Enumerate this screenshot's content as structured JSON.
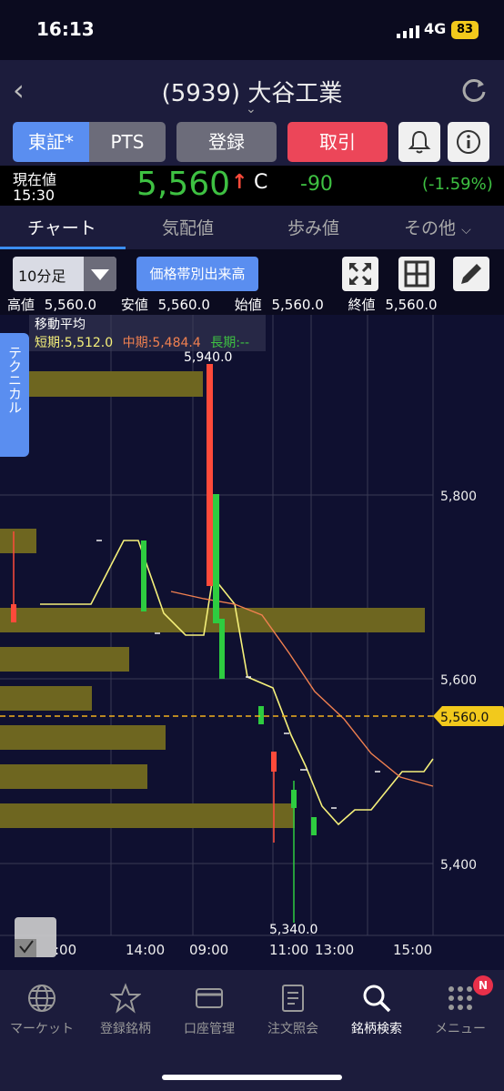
{
  "status": {
    "time": "16:13",
    "network": "4G",
    "battery": "83"
  },
  "header": {
    "title": "(5939) 大谷工業"
  },
  "buttons": {
    "tse": "東証*",
    "pts": "PTS",
    "register": "登録",
    "trade": "取引"
  },
  "price": {
    "label": "現在値",
    "time": "15:30",
    "value": "5,560",
    "flag": "C",
    "change": "-90",
    "change_pct": "(-1.59%)"
  },
  "tabs": [
    "チャート",
    "気配値",
    "歩み値",
    "その他"
  ],
  "controls": {
    "interval": "10分足",
    "volume_profile": "価格帯別出来高"
  },
  "ohlc": {
    "high_label": "高値",
    "high": "5,560.0",
    "low_label": "安値",
    "low": "5,560.0",
    "open_label": "始値",
    "open": "5,560.0",
    "close_label": "終値",
    "close": "5,560.0"
  },
  "ma": {
    "title": "移動平均",
    "short": "短期:5,512.0",
    "mid": "中期:5,484.4",
    "long": "長期:--"
  },
  "tech_tab": "テクニカル",
  "chart_data": {
    "type": "candlestick",
    "y_ticks": [
      "5,800",
      "5,600",
      "5,400"
    ],
    "x_ticks": [
      "14:00",
      "09:00",
      "11:00",
      "13:00",
      "15:00"
    ],
    "x_tick_partial": ":00",
    "current_price_label": "5,560.0",
    "high_label": "5,940.0",
    "low_label": "5,340.0",
    "colors": {
      "up": "#2ecc40",
      "down": "#ff4a3a",
      "ma_short": "#f5f07a",
      "ma_mid": "#f08050",
      "volume_bar": "#6e6620"
    }
  },
  "nav": [
    {
      "label": "マーケット",
      "icon": "globe-icon"
    },
    {
      "label": "登録銘柄",
      "icon": "star-icon"
    },
    {
      "label": "口座管理",
      "icon": "card-icon"
    },
    {
      "label": "注文照会",
      "icon": "document-icon"
    },
    {
      "label": "銘柄検索",
      "icon": "search-icon"
    },
    {
      "label": "メニュー",
      "icon": "menu-grid-icon"
    }
  ],
  "nav_badge": "N"
}
